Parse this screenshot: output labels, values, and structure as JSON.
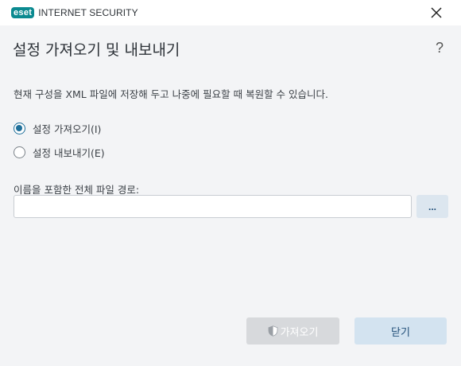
{
  "window": {
    "logo_text": "eset",
    "product_name": "INTERNET SECURITY",
    "close_icon": "close-icon"
  },
  "dialog": {
    "title": "설정 가져오기 및 내보내기",
    "help_label": "?",
    "description": "현재 구성을 XML 파일에 저장해 두고 나중에 필요할 때 복원할 수 있습니다.",
    "options": [
      {
        "label": "설정 가져오기(I)",
        "selected": true
      },
      {
        "label": "설정 내보내기(E)",
        "selected": false
      }
    ],
    "path_label": "이름을 포함한 전체 파일 경로:",
    "path_value": "",
    "browse_label": "...",
    "import_button": {
      "label": "가져오기",
      "icon": "shield-icon",
      "enabled": false
    },
    "close_button": {
      "label": "닫기"
    }
  },
  "colors": {
    "accent": "#1f6f9a",
    "logo": "#0b8a90",
    "background": "#f3f4f6"
  }
}
